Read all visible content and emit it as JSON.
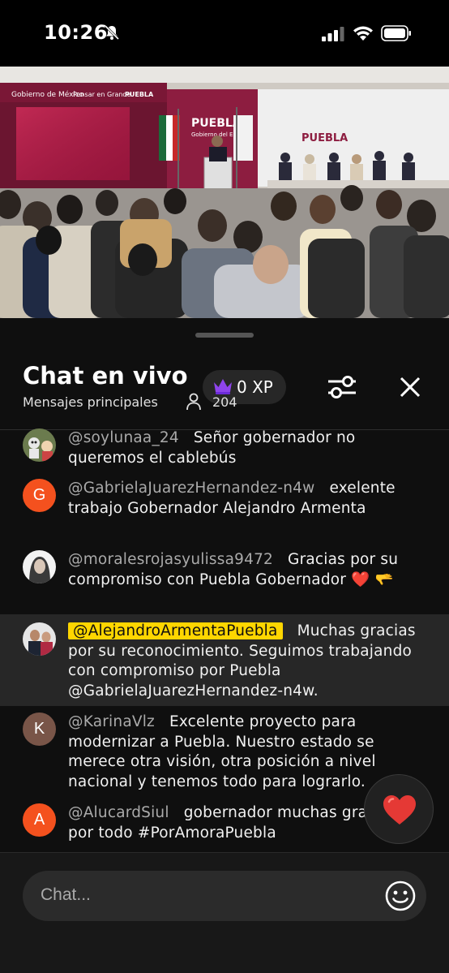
{
  "status_bar": {
    "time": "10:26"
  },
  "video": {
    "banner_left": "Gobierno de México",
    "banner_logo_1": "Pensar en Grande",
    "banner_logo_2": "PUEBLA",
    "backdrop_title": "PUEBLA",
    "backdrop_subtitle": "Gobierno del Estado",
    "backdrop_right": "PUEBLA"
  },
  "chat": {
    "title": "Chat en vivo",
    "subtitle": "Mensajes principales",
    "viewers": "204",
    "xp": "0 XP",
    "input_placeholder": "Chat...",
    "messages": [
      {
        "author": "@soylunaa_24",
        "text": "Señor gobernador no queremos el cablebús",
        "avatar": "photo"
      },
      {
        "author": "@GabrielaJuarezHernandez-n4w",
        "text": "exelente trabajo Gobernador Alejandro Armenta",
        "avatar_letter": "G",
        "avatar_color": "#f4511e"
      },
      {
        "author": "@moralesrojasyulissa9472",
        "text": "Gracias por su compromiso con Puebla Gobernador ❤️ 🫳",
        "avatar": "photo"
      },
      {
        "author": "@AlejandroArmentaPuebla",
        "text": "Muchas gracias por su reconocimiento. Seguimos trabajando con compromiso por Puebla @GabrielaJuarezHernandez-n4w.",
        "avatar": "photo",
        "owner": true
      },
      {
        "author": "@KarinaVlz",
        "text": "Excelente proyecto para modernizar a Puebla. Nuestro estado se merece otra visión, otra posición a nivel nacional y tenemos todo para lograrlo.",
        "avatar_letter": "K",
        "avatar_color": "#795548"
      },
      {
        "author": "@AlucardSiul",
        "text": "gobernador muchas gracias por todo #PorAmoraPuebla",
        "avatar_letter": "A",
        "avatar_color": "#f4511e"
      }
    ]
  },
  "colors": {
    "owner_badge": "#ffd600",
    "heart": "#e53935",
    "panel_bg": "#0f0f0f"
  },
  "icons": [
    "bell-slash-icon",
    "signal-icon",
    "wifi-icon",
    "battery-icon",
    "crown-icon",
    "person-icon",
    "tune-icon",
    "close-icon",
    "heart-icon",
    "emoji-icon"
  ]
}
